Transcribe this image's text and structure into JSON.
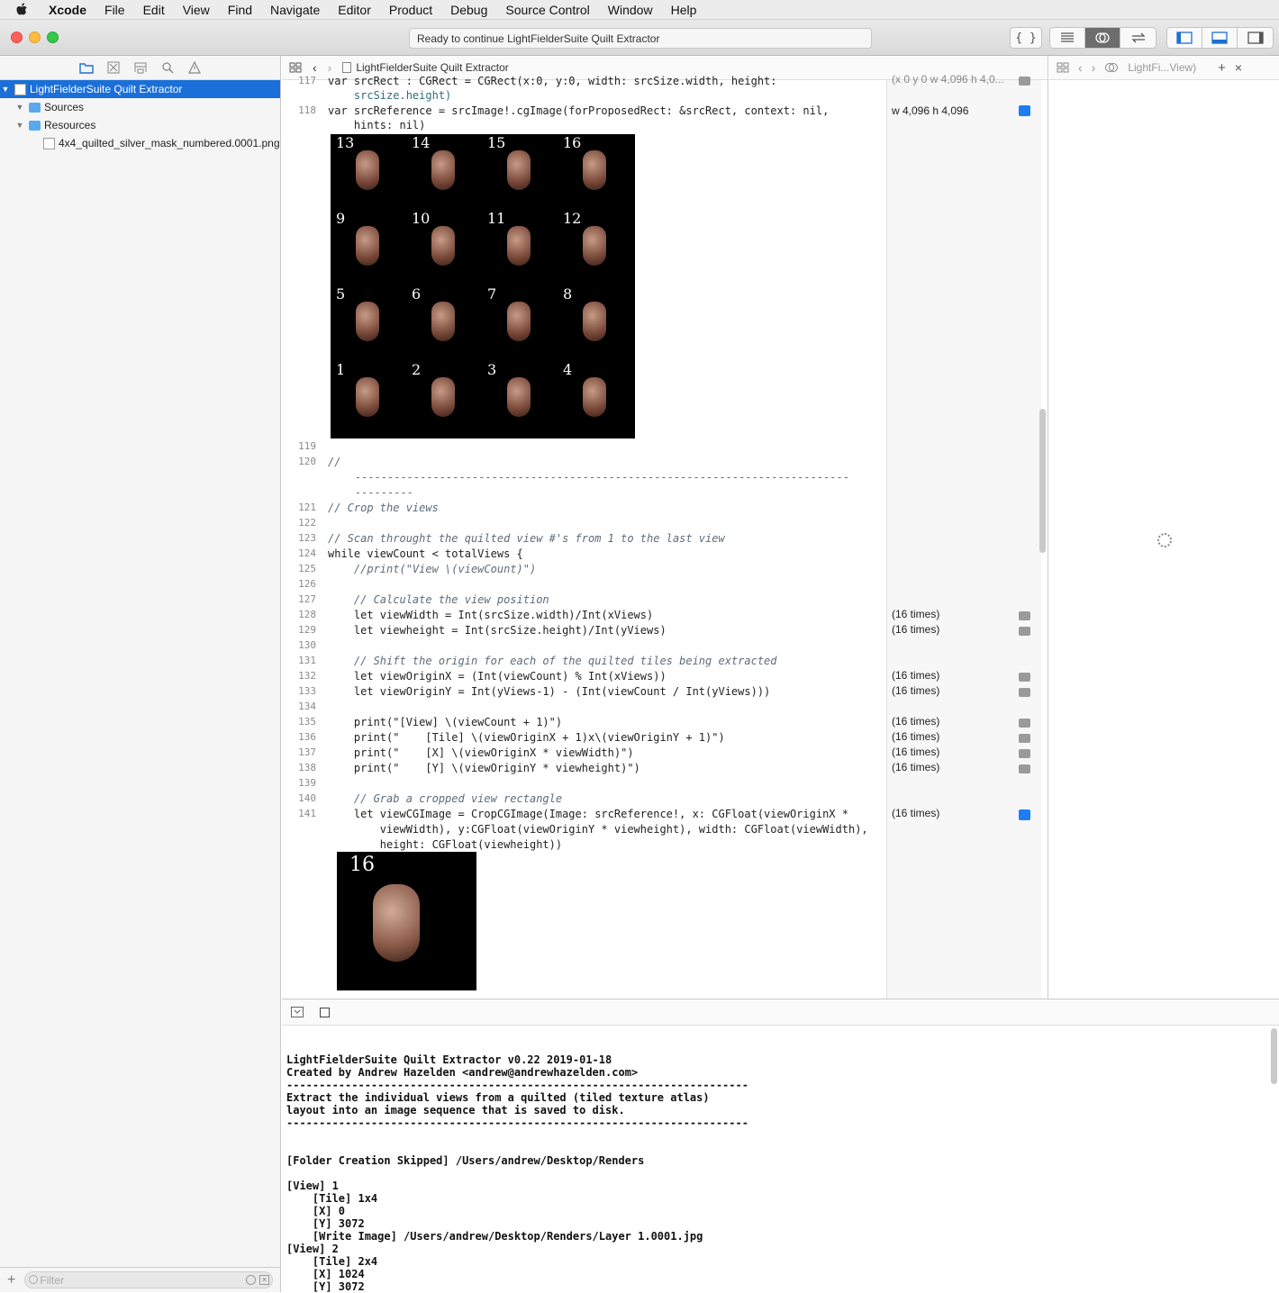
{
  "menubar": {
    "app": "Xcode",
    "items": [
      "File",
      "Edit",
      "View",
      "Find",
      "Navigate",
      "Editor",
      "Product",
      "Debug",
      "Source Control",
      "Window",
      "Help"
    ]
  },
  "toolbar": {
    "activity_status": "Ready to continue LightFielderSuite Quilt Extractor"
  },
  "navigator": {
    "project": "LightFielderSuite Quilt Extractor",
    "groups": [
      {
        "label": "Sources"
      },
      {
        "label": "Resources",
        "children": [
          "4x4_quilted_silver_mask_numbered.0001.png"
        ]
      }
    ],
    "filter_placeholder": "Filter"
  },
  "editor": {
    "jump_file": "LightFielderSuite Quilt Extractor",
    "lines": [
      {
        "n": "117",
        "text": "var srcRect : CGRect = CGRect(x:0, y:0, width: srcSize.width, height:",
        "cont": "    srcSize.height)",
        "result": "(x 0 y 0 w 4,096 h 4,0...",
        "qb": "gray"
      },
      {
        "n": "118",
        "text": "var srcReference = srcImage!.cgImage(forProposedRect: &srcRect, context: nil,",
        "cont": "    hints: nil)",
        "result": "w 4,096 h 4,096",
        "qb": "blue"
      },
      {
        "n": "119",
        "text": ""
      },
      {
        "n": "120",
        "text": "//"
      },
      {
        "n": "121",
        "text": "// Crop the views"
      },
      {
        "n": "122",
        "text": ""
      },
      {
        "n": "123",
        "text": "// Scan throught the quilted view #'s from 1 to the last view"
      },
      {
        "n": "124",
        "text": "while viewCount < totalViews {"
      },
      {
        "n": "125",
        "text": "    //print(\"View \\(viewCount)\")"
      },
      {
        "n": "126",
        "text": ""
      },
      {
        "n": "127",
        "text": "    // Calculate the view position"
      },
      {
        "n": "128",
        "text": "    let viewWidth = Int(srcSize.width)/Int(xViews)",
        "result": "(16 times)"
      },
      {
        "n": "129",
        "text": "    let viewheight = Int(srcSize.height)/Int(yViews)",
        "result": "(16 times)"
      },
      {
        "n": "130",
        "text": ""
      },
      {
        "n": "131",
        "text": "    // Shift the origin for each of the quilted tiles being extracted"
      },
      {
        "n": "132",
        "text": "    let viewOriginX = (Int(viewCount) % Int(xViews))",
        "result": "(16 times)"
      },
      {
        "n": "133",
        "text": "    let viewOriginY = Int(yViews-1) - (Int(viewCount / Int(yViews)))",
        "result": "(16 times)"
      },
      {
        "n": "134",
        "text": ""
      },
      {
        "n": "135",
        "text": "    print(\"[View] \\(viewCount + 1)\")",
        "result": "(16 times)"
      },
      {
        "n": "136",
        "text": "    print(\"    [Tile] \\(viewOriginX + 1)x\\(viewOriginY + 1)\")",
        "result": "(16 times)"
      },
      {
        "n": "137",
        "text": "    print(\"    [X] \\(viewOriginX * viewWidth)\")",
        "result": "(16 times)"
      },
      {
        "n": "138",
        "text": "    print(\"    [Y] \\(viewOriginY * viewheight)\")",
        "result": "(16 times)"
      },
      {
        "n": "139",
        "text": ""
      },
      {
        "n": "140",
        "text": "    // Grab a cropped view rectangle"
      },
      {
        "n": "141",
        "text": "    let viewCGImage = CropCGImage(Image: srcReference!, x: CGFloat(viewOriginX *",
        "cont": "        viewWidth), y:CGFloat(viewOriginY * viewheight), width: CGFloat(viewWidth),",
        "cont2": "        height: CGFloat(viewheight))",
        "result": "(16 times)",
        "qb": "blue"
      }
    ],
    "quilt_tiles": [
      "13",
      "14",
      "15",
      "16",
      "9",
      "10",
      "11",
      "12",
      "5",
      "6",
      "7",
      "8",
      "1",
      "2",
      "3",
      "4"
    ],
    "crop_tile": "16"
  },
  "assistant": {
    "jump": "LightFi...View)"
  },
  "console": {
    "output": "LightFielderSuite Quilt Extractor v0.22 2019-01-18\nCreated by Andrew Hazelden <andrew@andrewhazelden.com>\n-----------------------------------------------------------------------\nExtract the individual views from a quilted (tiled texture atlas)\nlayout into an image sequence that is saved to disk.\n-----------------------------------------------------------------------\n\n\n[Folder Creation Skipped] /Users/andrew/Desktop/Renders\n\n[View] 1\n    [Tile] 1x4\n    [X] 0\n    [Y] 3072\n    [Write Image] /Users/andrew/Desktop/Renders/Layer 1.0001.jpg\n[View] 2\n    [Tile] 2x4\n    [X] 1024\n    [Y] 3072"
  }
}
